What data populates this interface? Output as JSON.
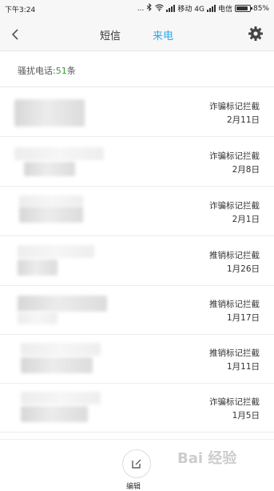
{
  "status_bar": {
    "time": "下午3:24",
    "dots": "...",
    "carrier1": "移动 4G",
    "carrier2": "电信",
    "battery": "85%",
    "battery_level": 0.85
  },
  "header": {
    "tab_sms": "短信",
    "tab_calls": "来电",
    "active_tab": "来电",
    "accent_color": "#2fa9e8"
  },
  "summary": {
    "label": "骚扰电话:",
    "count": "51",
    "unit": "条",
    "count_color": "#3a9a3a"
  },
  "calls": [
    {
      "tag": "诈骗标记拦截",
      "date": "2月11日"
    },
    {
      "tag": "诈骗标记拦截",
      "date": "2月8日"
    },
    {
      "tag": "诈骗标记拦截",
      "date": "2月1日"
    },
    {
      "tag": "推销标记拦截",
      "date": "1月26日"
    },
    {
      "tag": "推销标记拦截",
      "date": "1月17日"
    },
    {
      "tag": "推销标记拦截",
      "date": "1月11日"
    },
    {
      "tag": "诈骗标记拦截",
      "date": "1月5日"
    }
  ],
  "bottom": {
    "edit_label": "编辑"
  },
  "watermark": "Bai 经验",
  "icons": [
    "back-arrow-icon",
    "gear-icon",
    "edit-icon",
    "bluetooth-icon",
    "wifi-icon",
    "signal-icon",
    "battery-icon"
  ]
}
